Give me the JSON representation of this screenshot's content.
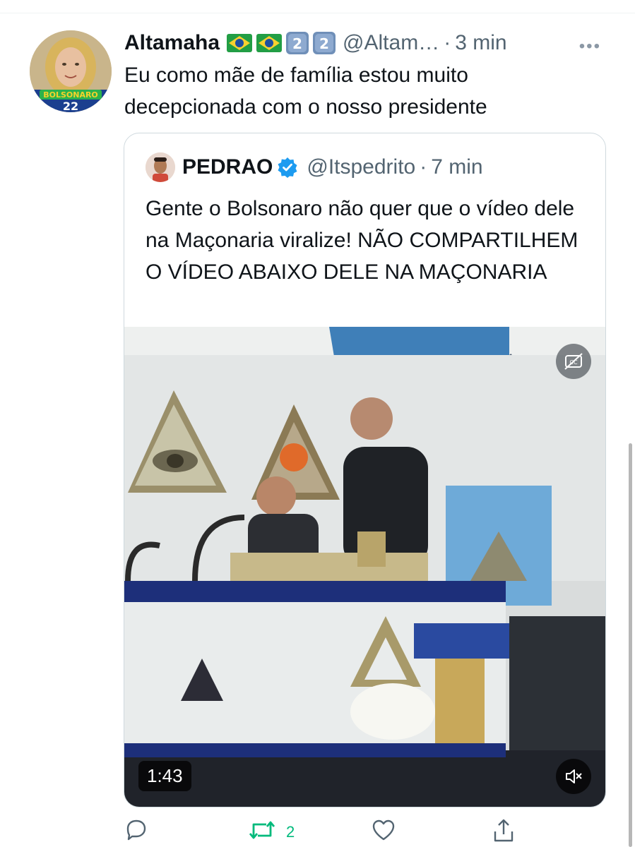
{
  "tweet": {
    "display_name": "Altamaha",
    "handle": "@Altam…",
    "separator": "·",
    "time": "3 min",
    "more": "•••",
    "text": "Eu como mãe de família estou muito decepcionada com o nosso presidente",
    "emojis": [
      "brazil-flag-icon",
      "brazil-flag-icon",
      "keycap-2-icon",
      "keycap-2-icon"
    ],
    "avatar_badge_text": "BOLSONARO",
    "avatar_badge_number": "22"
  },
  "quote": {
    "display_name": "PEDRAO",
    "handle": "@Itspedrito",
    "separator": "·",
    "time": "7 min",
    "text": "Gente o Bolsonaro não quer que o vídeo dele na Maçonaria viralize! NÃO COMPARTILHEM O VÍDEO ABAIXO DELE NA MAÇONARIA",
    "verified_icon": "verified-badge-icon",
    "video": {
      "duration": "1:43",
      "cc_icon": "closed-captions-off-icon",
      "mute_icon": "muted-speaker-icon"
    }
  },
  "actions": {
    "reply_icon": "reply-icon",
    "retweet_icon": "retweet-icon",
    "retweet_count": "2",
    "like_icon": "heart-icon",
    "share_icon": "share-icon"
  },
  "colors": {
    "text": "#0f1419",
    "secondary": "#536471",
    "retweet": "#00ba7c",
    "verified": "#1d9bf0",
    "border": "#cfd9de"
  }
}
